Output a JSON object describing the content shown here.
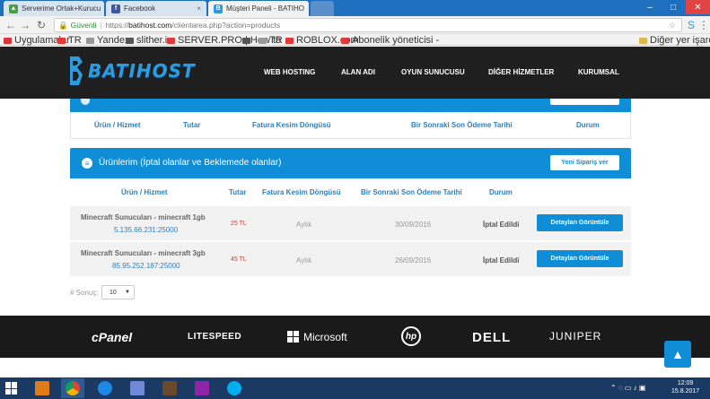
{
  "browser": {
    "tabs": [
      {
        "title": "Serverime Ortak+Kurucu",
        "icon": "shield-icon",
        "color": "#4a9d4a"
      },
      {
        "title": "Facebook",
        "icon": "facebook-icon",
        "color": "#3b5998"
      },
      {
        "title": "Müşteri Paneli - BATIHO",
        "icon": "batihost-icon",
        "color": "#2c9be0"
      }
    ],
    "security_label": "Güvenli",
    "url_protocol": "https://",
    "url_host": "batihost.com",
    "url_path": "/clientarea.php?action=products",
    "bookmarks": [
      {
        "label": "Uygulamalar",
        "color": "#d33"
      },
      {
        "label": "TR",
        "color": "#e53935"
      },
      {
        "label": "Yandex",
        "color": "#999"
      },
      {
        "label": "slither.io",
        "color": "#555"
      },
      {
        "label": "SERVER.PRO | How to",
        "color": "#e53935"
      },
      {
        "label": "",
        "color": "#555"
      },
      {
        "label": "TR",
        "color": "#999"
      },
      {
        "label": "ROBLOX.com",
        "color": "#e53935"
      },
      {
        "label": "Abonelik yöneticisi -",
        "color": "#e53935"
      }
    ],
    "other_bookmarks": "Diğer yer işaretleri"
  },
  "site": {
    "logo_text": "BATIHOST",
    "nav": [
      "WEB HOSTING",
      "ALAN ADI",
      "OYUN SUNUCUSU",
      "DİĞER HİZMETLER",
      "KURUMSAL"
    ]
  },
  "table1": {
    "headers": [
      "Ürün / Hizmet",
      "Tutar",
      "Fatura Kesim Döngüsü",
      "Bir Sonraki Son Ödeme Tarihi",
      "Durum"
    ]
  },
  "table2": {
    "title": "Ürünlerim (İptal olanlar ve Beklemede olanlar)",
    "new_order": "Yeni Sipariş ver",
    "headers": [
      "Ürün / Hizmet",
      "Tutar",
      "Fatura Kesim Döngüsü",
      "Bir Sonraki Son Ödeme Tarihi",
      "Durum"
    ],
    "rows": [
      {
        "product": "Minecraft Sunucuları - minecraft 1gb",
        "ip": "5.135.66.231:25000",
        "amount": "25  TL",
        "cycle": "Aylık",
        "date": "30/09/2016",
        "status": "İptal Edildi",
        "action": "Detayları Görüntüle"
      },
      {
        "product": "Minecraft Sunucuları - minecraft 3gb",
        "ip": "85.95.252.187:25000",
        "amount": "45  TL",
        "cycle": "Aylık",
        "date": "26/09/2016",
        "status": "İptal Edildi",
        "action": "Detayları Görüntüle"
      }
    ],
    "results_label": "# Sonuç:",
    "results_value": "10"
  },
  "brands": [
    "cPanel",
    "LITESPEED",
    "Microsoft",
    "hp",
    "DELL",
    "JUNIPER"
  ],
  "clock": {
    "time": "12:09",
    "date": "15.8.2017"
  }
}
